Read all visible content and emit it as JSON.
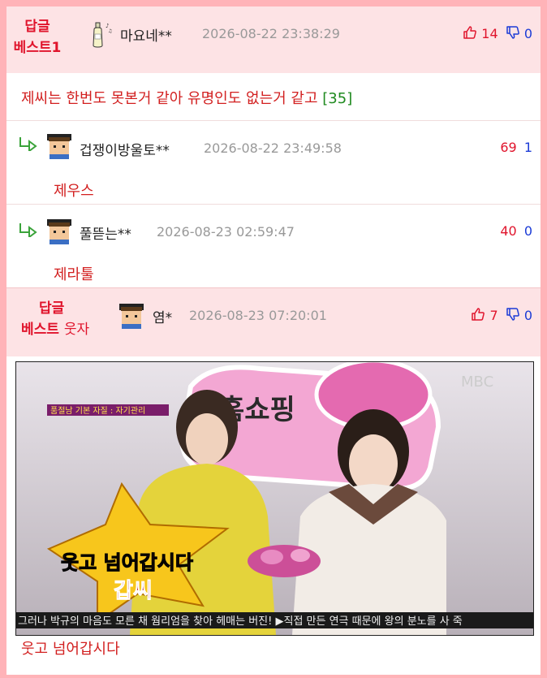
{
  "best1": {
    "label_line1": "답글",
    "label_line2": "베스트1",
    "nickname": "마요네**",
    "datetime": "2026-08-22 23:38:29",
    "upvotes": "14",
    "downvotes": "0",
    "comment": "제씨는 한번도 못본거 같아 유명인도 없는거 같고",
    "reply_count": "[35]"
  },
  "replies": [
    {
      "nickname": "겁쟁이방울토**",
      "datetime": "2026-08-22 23:49:58",
      "upvotes": "69",
      "downvotes": "1",
      "text": "제우스"
    },
    {
      "nickname": "풀뜯는**",
      "datetime": "2026-08-23 02:59:47",
      "upvotes": "40",
      "downvotes": "0",
      "text": "제라툴"
    }
  ],
  "best2": {
    "label_line1": "답글",
    "label_line2_bold": "베스트",
    "label_line2_sub": "웃자",
    "nickname": "염*",
    "datetime": "2026-08-23 07:20:01",
    "upvotes": "7",
    "downvotes": "0",
    "caption": "웃고 넘어갑시다"
  },
  "photo": {
    "channel_logo": "MBC",
    "sign_text": "홈쇼핑",
    "top_caption": "품절남 기본 자질 : 자기관리",
    "title_line1": "웃고 넘어갑시다",
    "title_line2": "갑씨",
    "ticker": "그러나 박규의 마음도 모른 채 웜리엄을 찾아 헤매는 버진!  ▶직접 만든 연극 때문에 왕의 분노를 사 죽"
  },
  "colors": {
    "accent_red": "#e0142c",
    "border_pink": "#ffb3b8",
    "header_pink": "#fde3e5",
    "down_blue": "#1b3bd6"
  }
}
